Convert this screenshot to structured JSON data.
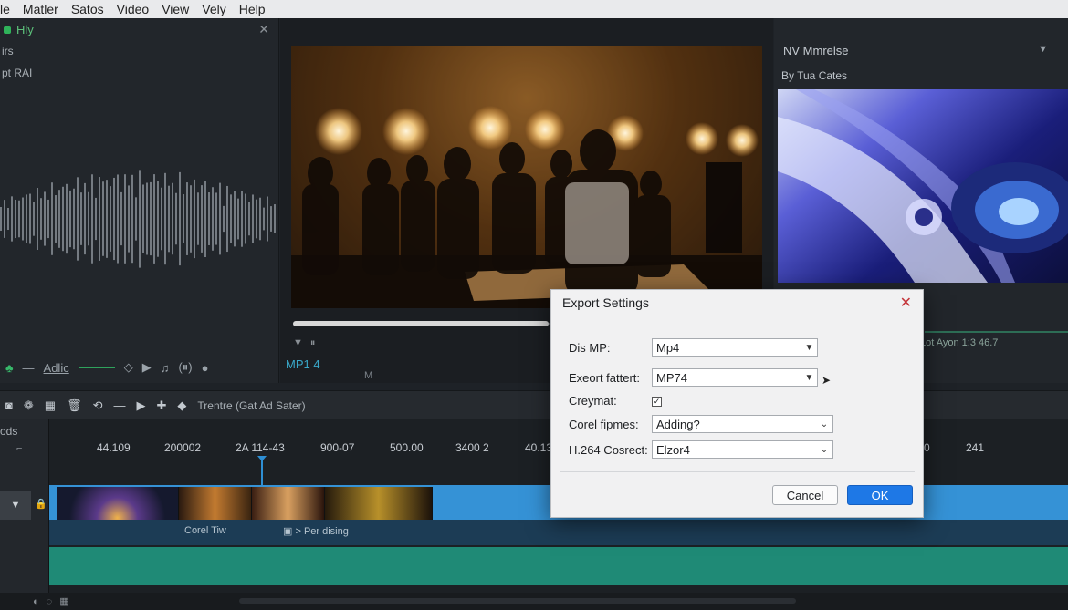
{
  "menu": [
    "le",
    "Matler",
    "Satos",
    "Video",
    "View",
    "Vely",
    "Help"
  ],
  "left_panel": {
    "header": "Hly",
    "line1": "irs",
    "line2": "pt RAI",
    "controls_label": "Adlic"
  },
  "center_panel": {
    "timecode": "MP1 4",
    "small_label": "M"
  },
  "right_panel": {
    "title": "NV Mmrelse",
    "subtitle": "By Tua Cates",
    "time": "Lot Ayon 1:3 46.7"
  },
  "toolbar": {
    "label": "Trentre (Gat Ad Sater)"
  },
  "timeline": {
    "track_label": "ods",
    "ruler": [
      {
        "label": "44.109",
        "pos": 0.047
      },
      {
        "label": "200002",
        "pos": 0.113
      },
      {
        "label": "2A 114-43",
        "pos": 0.183
      },
      {
        "label": "900-07",
        "pos": 0.266
      },
      {
        "label": "500.00",
        "pos": 0.334
      },
      {
        "label": "3400 2",
        "pos": 0.399
      },
      {
        "label": "40.13",
        "pos": 0.467
      },
      {
        "label": "0",
        "pos": 0.858
      },
      {
        "label": "241",
        "pos": 0.9
      }
    ],
    "clip_label1": "Corel Tiw",
    "clip_label2": "Per dising"
  },
  "dialog": {
    "title": "Export Settings",
    "rows": [
      {
        "label": "Dis MP:",
        "value": "Mp4"
      },
      {
        "label": "Exeort fattert:",
        "value": "MP74"
      },
      {
        "label": "Creymat:"
      },
      {
        "label": "Corel fipmes:",
        "value": "Adding?"
      },
      {
        "label": "H.264 Cosrect:",
        "value": "Elzor4"
      }
    ],
    "cancel": "Cancel",
    "ok": "OK"
  },
  "colors": {
    "accent": "#1e78e6",
    "video_track": "#3592d6",
    "audio_track": "#1f8a76",
    "green": "#2fb35a"
  }
}
